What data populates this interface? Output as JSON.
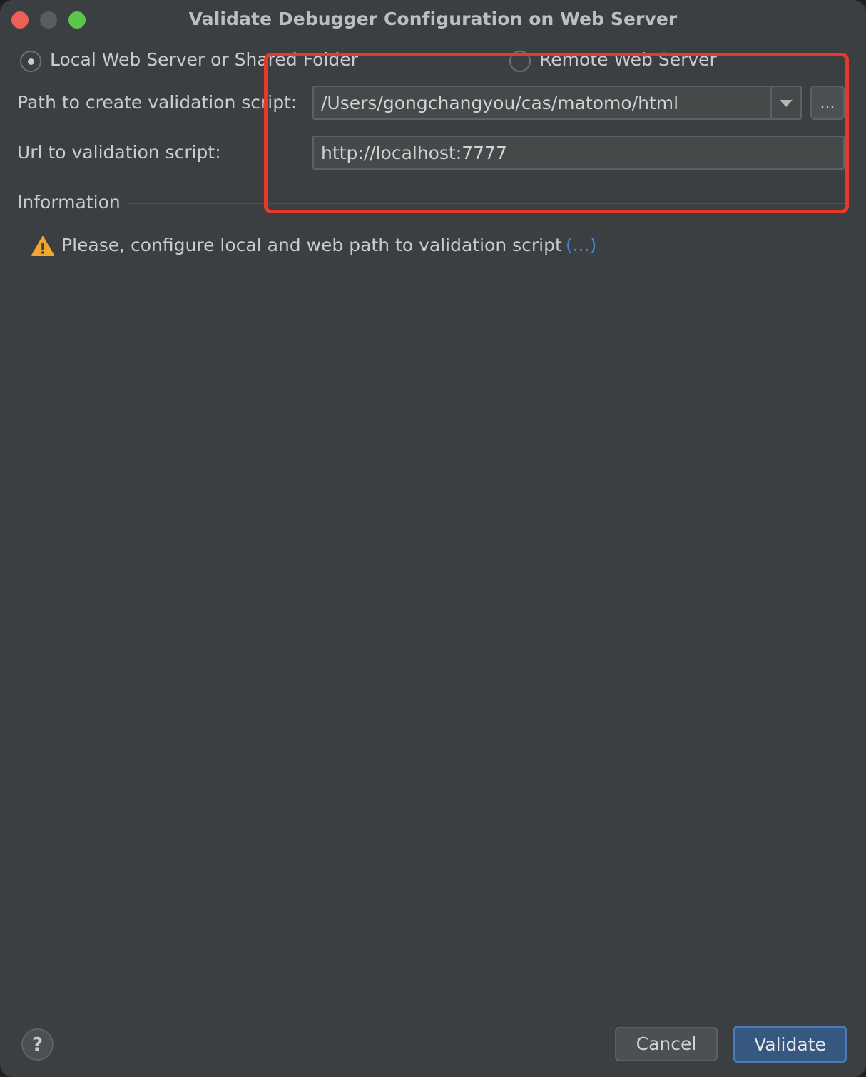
{
  "window": {
    "title": "Validate Debugger Configuration on Web Server"
  },
  "mode": {
    "local_label": "Local Web Server or Shared Folder",
    "remote_label": "Remote Web Server",
    "selected": "local"
  },
  "form": {
    "path_label": "Path to create validation script:",
    "path_value": "/Users/gongchangyou/cas/matomo/html",
    "browse_label": "...",
    "url_label": "Url to validation script:",
    "url_value": "http://localhost:7777"
  },
  "information": {
    "heading": "Information",
    "message": "Please, configure local and web path to validation script",
    "more_link": "(...)"
  },
  "footer": {
    "help_label": "?",
    "cancel_label": "Cancel",
    "validate_label": "Validate"
  },
  "colors": {
    "highlight": "#e8382c",
    "link": "#3f8be0",
    "warning": "#f0a732",
    "primary_button": "#365880"
  },
  "icons": [
    "warning-icon",
    "chevron-down-icon"
  ]
}
